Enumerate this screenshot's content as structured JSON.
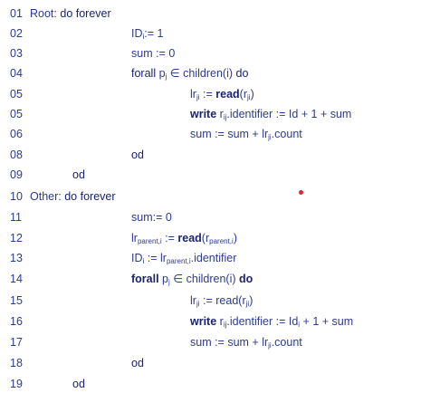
{
  "lines": [
    {
      "num": "01",
      "label": "Root:",
      "kw": "do forever"
    },
    {
      "num": "02",
      "text_a": "ID",
      "sub_a": "i",
      "text_b": ":= 1"
    },
    {
      "num": "03",
      "text": "sum := 0"
    },
    {
      "num": "04",
      "kw": "forall",
      "p": "p",
      "p_sub": "j",
      "rest": "∈ children(i)",
      "kw2": "do"
    },
    {
      "num": "05",
      "lr": "lr",
      "lr_sub": "ji",
      "assign": ":=",
      "read": "read",
      "rarg_open": "(r",
      "rarg_sub": "ji",
      "rarg_close": ")"
    },
    {
      "num": "05",
      "write": "write",
      "r": "r",
      "r_sub": "ij",
      "rest": ".identifier := Id + 1 + sum"
    },
    {
      "num": "06",
      "text_a": "sum := sum + lr",
      "sub_a": "ji",
      "text_b": ".count"
    },
    {
      "num": "08",
      "kw": "od"
    },
    {
      "num": "09",
      "kw": "od"
    },
    {
      "num": "10",
      "label": "Other:",
      "kw": "do forever"
    },
    {
      "num": "11",
      "text": "sum:= 0"
    },
    {
      "num": "12",
      "lr": "lr",
      "lr_sub": "parent,i",
      "assign": ":=",
      "read": "read",
      "rarg_open": "(r",
      "rarg_sub": "parent,i",
      "rarg_close": ")"
    },
    {
      "num": "13",
      "text_a": "ID",
      "sub_a": "i",
      "text_b": ":= lr",
      "sub_b": "parent,i",
      "text_c": ".identifier"
    },
    {
      "num": "14",
      "kw": "forall",
      "p": "p",
      "p_sub": "j",
      "rest": "∈ children(i)",
      "kw2": "do"
    },
    {
      "num": "15",
      "lr": "lr",
      "lr_sub": "ji",
      "assign": ":=",
      "read": "read",
      "rarg_open": "(r",
      "rarg_sub": "ji",
      "rarg_close": ")"
    },
    {
      "num": "16",
      "write": "write",
      "r": "r",
      "r_sub": "ij",
      "rest_a": ".identifier := Id",
      "rest_sub": "i",
      "rest_b": "+ 1 + sum"
    },
    {
      "num": "17",
      "text_a": "sum := sum + lr",
      "sub_a": "ji",
      "text_b": ".count"
    },
    {
      "num": "18",
      "kw": "od"
    },
    {
      "num": "19",
      "kw": "od"
    }
  ],
  "colors": {
    "text": "#2d3b8e",
    "keyword": "#1a2470",
    "pointer_dot": "#e0262b"
  }
}
